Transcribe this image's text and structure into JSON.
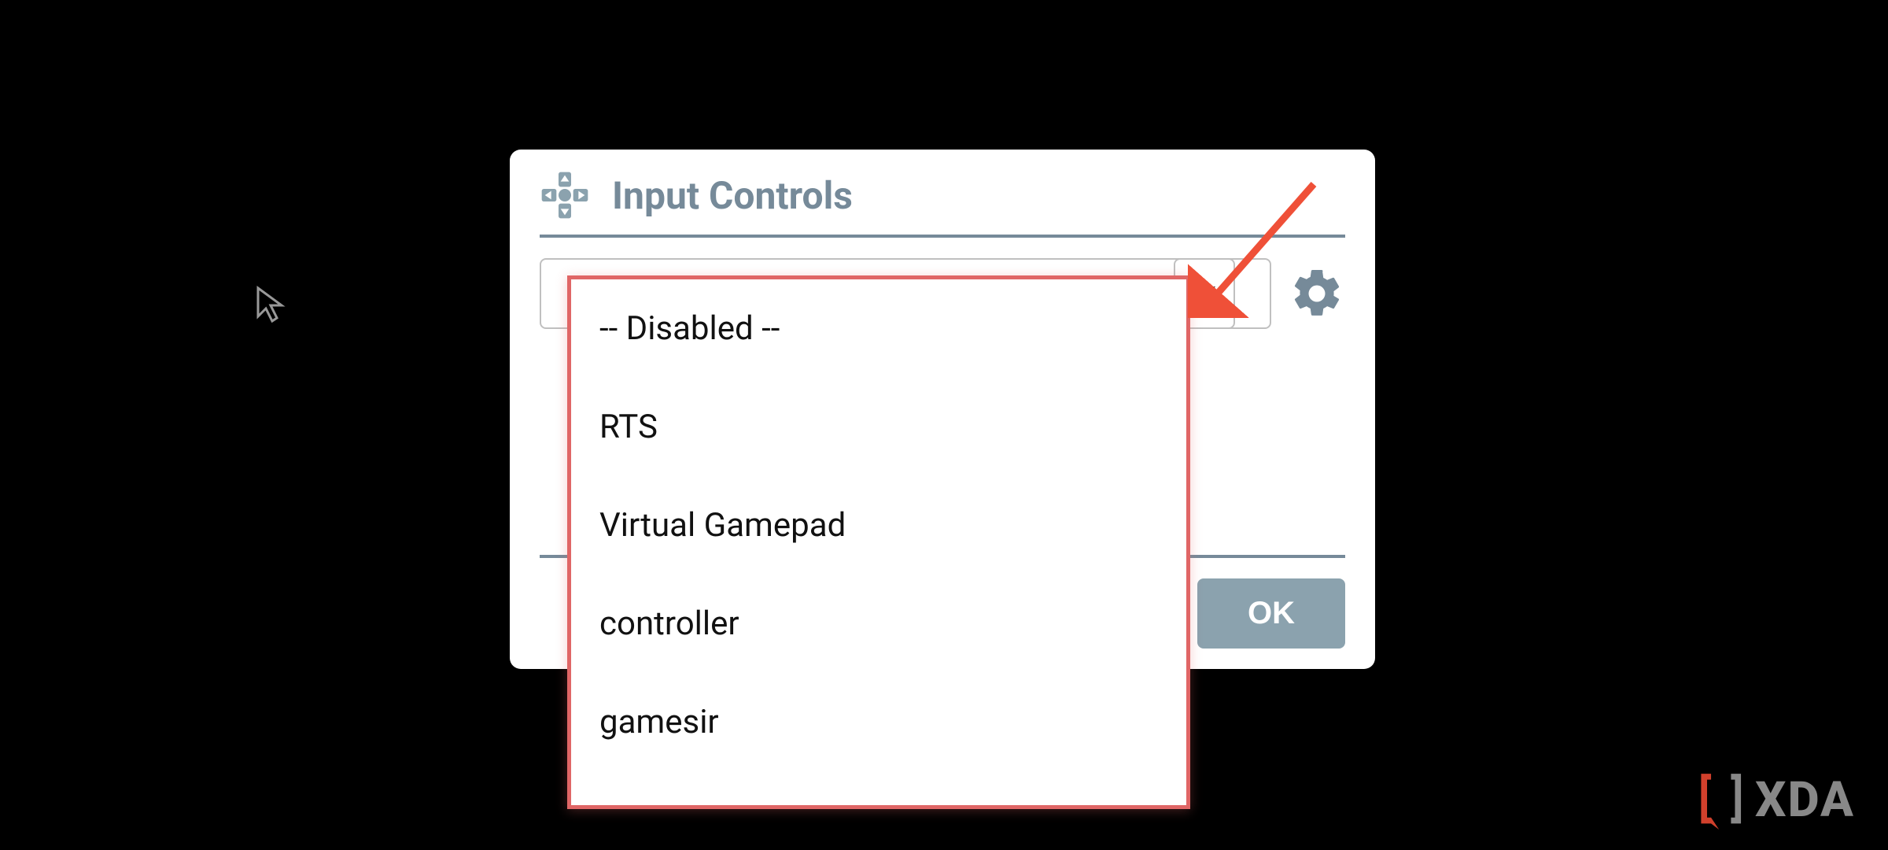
{
  "dialog": {
    "title": "Input Controls",
    "ok_label": "OK"
  },
  "dropdown": {
    "options": [
      "-- Disabled --",
      "RTS",
      "Virtual Gamepad",
      "controller",
      "gamesir"
    ]
  },
  "watermark": {
    "text": "XDA"
  }
}
